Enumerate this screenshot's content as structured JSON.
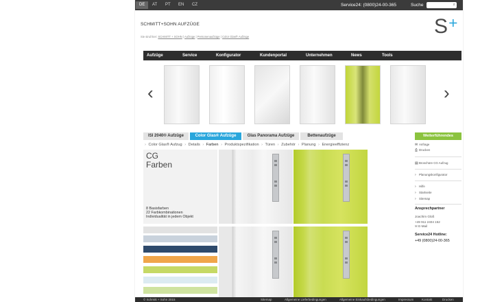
{
  "languages": [
    "DE",
    "AT",
    "PT",
    "EN",
    "CZ"
  ],
  "service": "Service24: (0800)24-00-365",
  "search_label": "Suche",
  "brand": "SCHMITT+SOHN AUFZÜGE",
  "breadcrumb": {
    "prefix": "Sie sind hier:",
    "items": [
      "SCHMITT + SOHN",
      "Aufzüge",
      "Personenaufzüge",
      "Color Glas® Aufzüge"
    ]
  },
  "logo": {
    "text": "S+",
    "color": "#4a4a4a",
    "accent": "#29a6dc"
  },
  "nav": [
    "Aufzüge",
    "Service",
    "Konfigurator",
    "Kundenportal",
    "Unternehmen",
    "News",
    "Tools"
  ],
  "carousel": {
    "prev": "‹",
    "next": "›",
    "thumb_count": 6
  },
  "tabs": [
    "ISI 2040® Aufzüge",
    "Color Glas® Aufzüge",
    "Glas Panorama Aufzüge",
    "Bettenaufzüge"
  ],
  "active_tab": 1,
  "subnav": [
    "Color Glas® Aufzug",
    "Details",
    "Farben",
    "Produktspezifikation",
    "Türen",
    "Zubehör",
    "Planung",
    "Energieeffizienz"
  ],
  "subnav_current": 2,
  "cg_panel": {
    "title1": "CG",
    "title2": "Farben",
    "desc1": "8 Basisfarben",
    "desc2": "22 Farbkombinationen",
    "desc3": "Individualität in jedem Objekt"
  },
  "swatch_colors": [
    "#e2e2e2",
    "#c9d2dc",
    "#2e4a6b",
    "#f0a64a",
    "#c6d965",
    "#dcebf2",
    "#cfe3a0"
  ],
  "sidebar": {
    "more_button": "Weiterführendes",
    "links1": [
      {
        "icon": "mail-icon",
        "glyph": "✉",
        "label": "Anfrage"
      },
      {
        "icon": "print-icon",
        "glyph": "⎙",
        "label": "Drucken"
      }
    ],
    "brochure": {
      "icon": "document-icon",
      "glyph": "▤",
      "label": "Broschüre CG Aufzug"
    },
    "planning": "Planungskonfigurator",
    "links2": [
      "Hilfe",
      "Startseite",
      "Sitemap"
    ],
    "contact_head": "Ansprechpartner",
    "contact_name": "Joachim Gloß",
    "contact_phone": "+49 911 2404 152",
    "contact_mail": "E-Mail",
    "hotline_head": "Service24 Hotline:",
    "hotline_number": "+49 (0800)24-00-365"
  },
  "footer": {
    "copyright": "© Schmitt + Sohn 2015",
    "links": [
      "Sitemap",
      "Allgemeine Lieferbedingungen",
      "Allgemeine Einkaufsbedingungen",
      "Impressum",
      "Kontakt",
      "Drucken"
    ]
  }
}
